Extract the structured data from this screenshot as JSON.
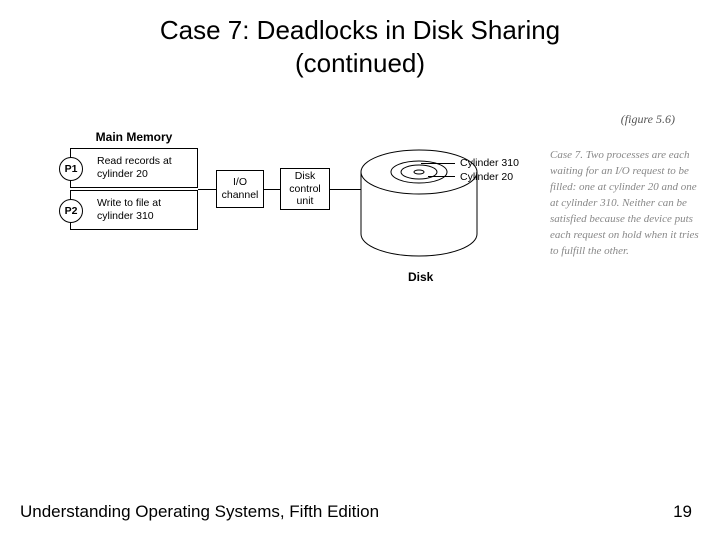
{
  "title_line1": "Case 7: Deadlocks in Disk Sharing",
  "title_line2": "(continued)",
  "diagram": {
    "main_memory_label": "Main Memory",
    "p1_name": "P1",
    "p1_text": "Read records at cylinder 20",
    "p2_name": "P2",
    "p2_text": "Write to file at cylinder 310",
    "io_channel": "I/O channel",
    "disk_control_unit": "Disk control unit",
    "cyl310": "Cylinder 310",
    "cyl20": "Cylinder 20",
    "disk_label": "Disk"
  },
  "figure_ref": "(figure 5.6)",
  "caption": "Case 7. Two processes are each waiting for an I/O request to be filled: one at cylinder 20 and one at cylinder 310. Neither can be satisfied because the device puts each request on hold when it tries to fulfill the other.",
  "footer_left": "Understanding Operating Systems, Fifth Edition",
  "footer_right": "19"
}
